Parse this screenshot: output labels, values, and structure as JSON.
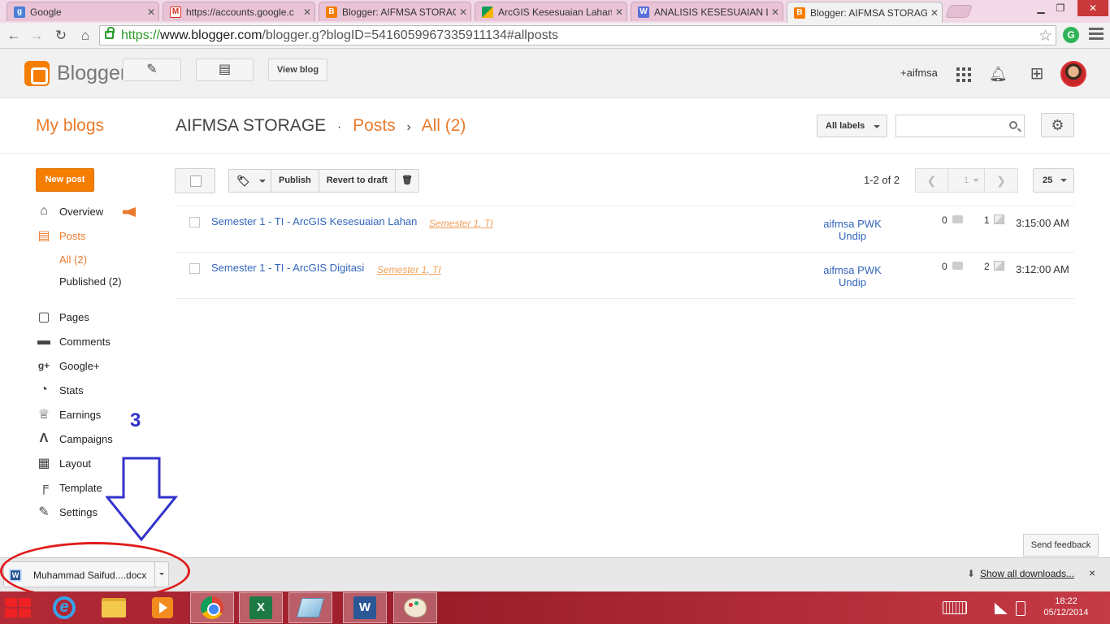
{
  "browser": {
    "tabs": [
      {
        "title": "Google",
        "icon": "google-icon",
        "color": "#4a7fd8"
      },
      {
        "title": "https://accounts.google.c",
        "icon": "gmail-icon",
        "color": "#d93025"
      },
      {
        "title": "Blogger: AIFMSA STORAG",
        "icon": "blogger-icon",
        "color": "#f57d00"
      },
      {
        "title": "ArcGIS Kesesuaian Lahan",
        "icon": "drive-icon",
        "color": "#0f9d58"
      },
      {
        "title": "ANALISIS KESESUAIAN LA",
        "icon": "word-icon",
        "color": "#5a6fd8"
      },
      {
        "title": "Blogger: AIFMSA STORAG",
        "icon": "blogger-icon",
        "color": "#f57d00"
      }
    ],
    "url_scheme": "https://",
    "url_host": "www.blogger.com",
    "url_rest": "/blogger.g?blogID=5416059967335911134#allposts",
    "ext_label": "G"
  },
  "header": {
    "brand": "Blogger",
    "view_blog": "View blog",
    "user": "+aifmsa"
  },
  "title_row": {
    "my_blogs": "My blogs",
    "blog_name": "AIFMSA STORAGE",
    "dot": "·",
    "section": "Posts",
    "arrow": "›",
    "filter": "All (2)",
    "labels_select": "All labels"
  },
  "sidebar": {
    "new_post": "New post",
    "items": [
      {
        "label": "Overview",
        "icon": "home-icon",
        "glyph": "⌂"
      },
      {
        "label": "Posts",
        "icon": "posts-icon",
        "glyph": "▤"
      },
      {
        "label": "Pages",
        "icon": "pages-icon",
        "glyph": "▢"
      },
      {
        "label": "Comments",
        "icon": "comments-icon",
        "glyph": "▬"
      },
      {
        "label": "Google+",
        "icon": "google-plus-icon",
        "glyph": "g+"
      },
      {
        "label": "Stats",
        "icon": "stats-icon",
        "glyph": "◔"
      },
      {
        "label": "Earnings",
        "icon": "trophy-icon",
        "glyph": "♕"
      },
      {
        "label": "Campaigns",
        "icon": "campaigns-icon",
        "glyph": "Λ"
      },
      {
        "label": "Layout",
        "icon": "layout-icon",
        "glyph": "▦"
      },
      {
        "label": "Template",
        "icon": "paint-roller-icon",
        "glyph": "╒"
      },
      {
        "label": "Settings",
        "icon": "wrench-icon",
        "glyph": "✎"
      }
    ],
    "sub_items": [
      "All (2)",
      "Published (2)"
    ]
  },
  "toolbar": {
    "publish": "Publish",
    "revert": "Revert to draft",
    "range": "1-2 of 2",
    "page": "1",
    "per_page": "25"
  },
  "posts": [
    {
      "title": "Semester 1 - TI - ArcGIS Kesesuaian Lahan",
      "labels": [
        "Semester 1",
        "TI"
      ],
      "author_line1": "aifmsa PWK",
      "author_line2": "Undip",
      "comments": "0",
      "views": "1",
      "time": "3:15:00 AM"
    },
    {
      "title": "Semester 1 - TI - ArcGIS Digitasi",
      "labels": [
        "Semester 1",
        "TI"
      ],
      "author_line1": "aifmsa PWK",
      "author_line2": "Undip",
      "comments": "0",
      "views": "2",
      "time": "3:12:00 AM"
    }
  ],
  "annotation": {
    "number": "3"
  },
  "feedback": "Send feedback",
  "downloads": {
    "file": "Muhammad Saifud....docx",
    "show_all": "Show all downloads...",
    "close": "×"
  },
  "taskbar": {
    "time": "18:22",
    "date": "05/12/2014",
    "excel_letter": "X",
    "word_letter": "W",
    "ie_letter": "e"
  },
  "colors": {
    "brand_orange": "#f57d00",
    "link_blue": "#3366bb",
    "annotation_red": "#e01c1c",
    "annotation_blue": "#3333cc"
  }
}
